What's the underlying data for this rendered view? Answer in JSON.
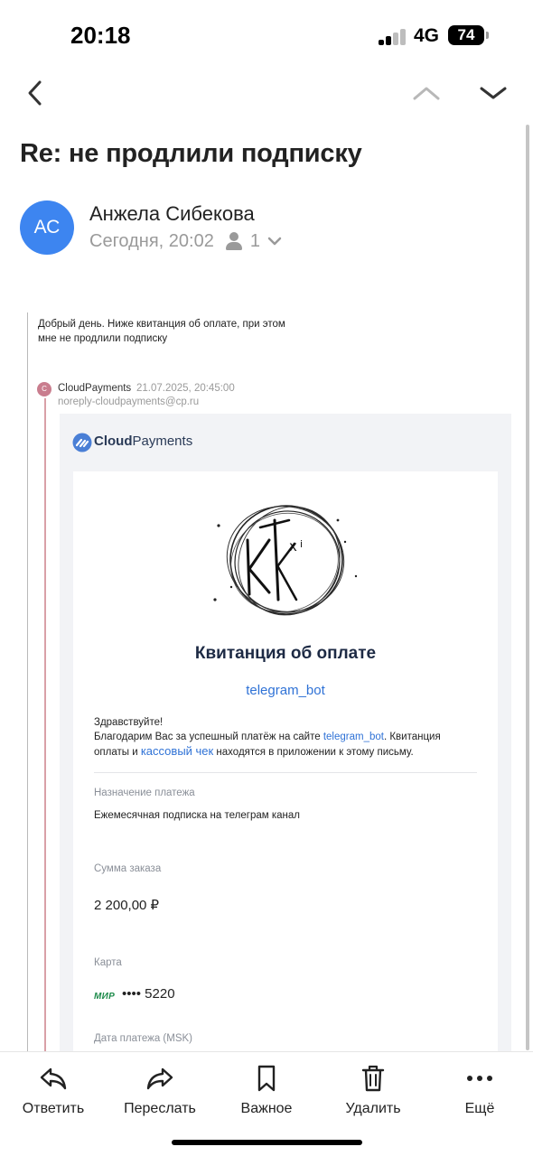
{
  "status_bar": {
    "time": "20:18",
    "network": "4G",
    "battery": "74"
  },
  "email": {
    "subject": "Re: не продлили подписку",
    "avatar_initials": "АС",
    "sender_name": "Анжела Сибекова",
    "date": "Сегодня, 20:02",
    "recipients_count": "1"
  },
  "quote": {
    "line1": "Добрый день. Ниже квитанция об оплате, при этом",
    "line2": "мне не продлили подписку"
  },
  "forwarded": {
    "avatar_letter": "C",
    "sender": "CloudPayments",
    "date": "21.07.2025, 20:45:00",
    "email": "noreply-cloudpayments@cp.ru"
  },
  "receipt": {
    "brand_bold": "Cloud",
    "brand_rest": "Payments",
    "title": "Квитанция об оплате",
    "merchant": "telegram_bot",
    "greeting": "Здравствуйте!",
    "body_part1": "Благодарим Вас за успешный платёж на сайте ",
    "body_link1": "telegram_bot",
    "body_part2": ". Квитанция",
    "body_part3": "оплаты и ",
    "body_link2": "кассовый чек",
    "body_part4": " находятся в приложении к этому письму.",
    "purpose_label": "Назначение платежа",
    "purpose_value": "Ежемесячная подписка на телеграм канал",
    "amount_label": "Сумма заказа",
    "amount_value": "2 200,00 ₽",
    "card_label": "Карта",
    "card_brand": "МИР",
    "card_number": "•••• 5220",
    "date_label": "Дата платежа (MSK)"
  },
  "toolbar": {
    "reply": "Ответить",
    "forward": "Переслать",
    "important": "Важное",
    "delete": "Удалить",
    "more": "Ещё"
  }
}
